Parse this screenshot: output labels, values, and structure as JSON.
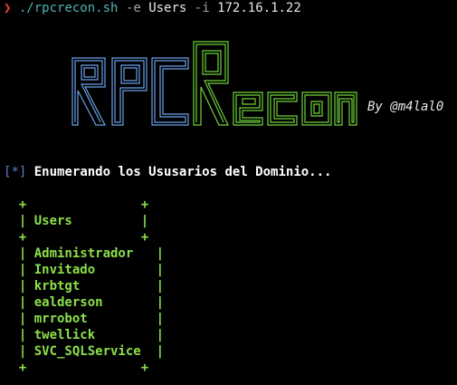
{
  "terminal": {
    "prompt_symbol": "❯",
    "command": "./rpcrecon.sh",
    "flag_e": "-e",
    "arg_e": "Users",
    "flag_i": "-i",
    "arg_i": "172.16.1.22"
  },
  "banner": {
    "logo_text": "RPCRecon",
    "author": "By @m4lal0",
    "colors": {
      "rpc": "#6aa0e8",
      "recon": "#6fd13a"
    }
  },
  "status": {
    "open_bracket": "[",
    "marker": "*",
    "close_bracket": "]",
    "message": "Enumerando los Ususarios del Dominio..."
  },
  "table": {
    "border_top": "  +               +",
    "header": "  | Users         |",
    "border_mid": "  +               +",
    "rows": [
      "  | Administrador   |",
      "  | Invitado        |",
      "  | krbtgt          |",
      "  | ealderson       |",
      "  | mrrobot         |",
      "  | twellick        |",
      "  | SVC_SQLService  |"
    ],
    "border_bottom": "  +               +",
    "color": "#8be04a"
  }
}
